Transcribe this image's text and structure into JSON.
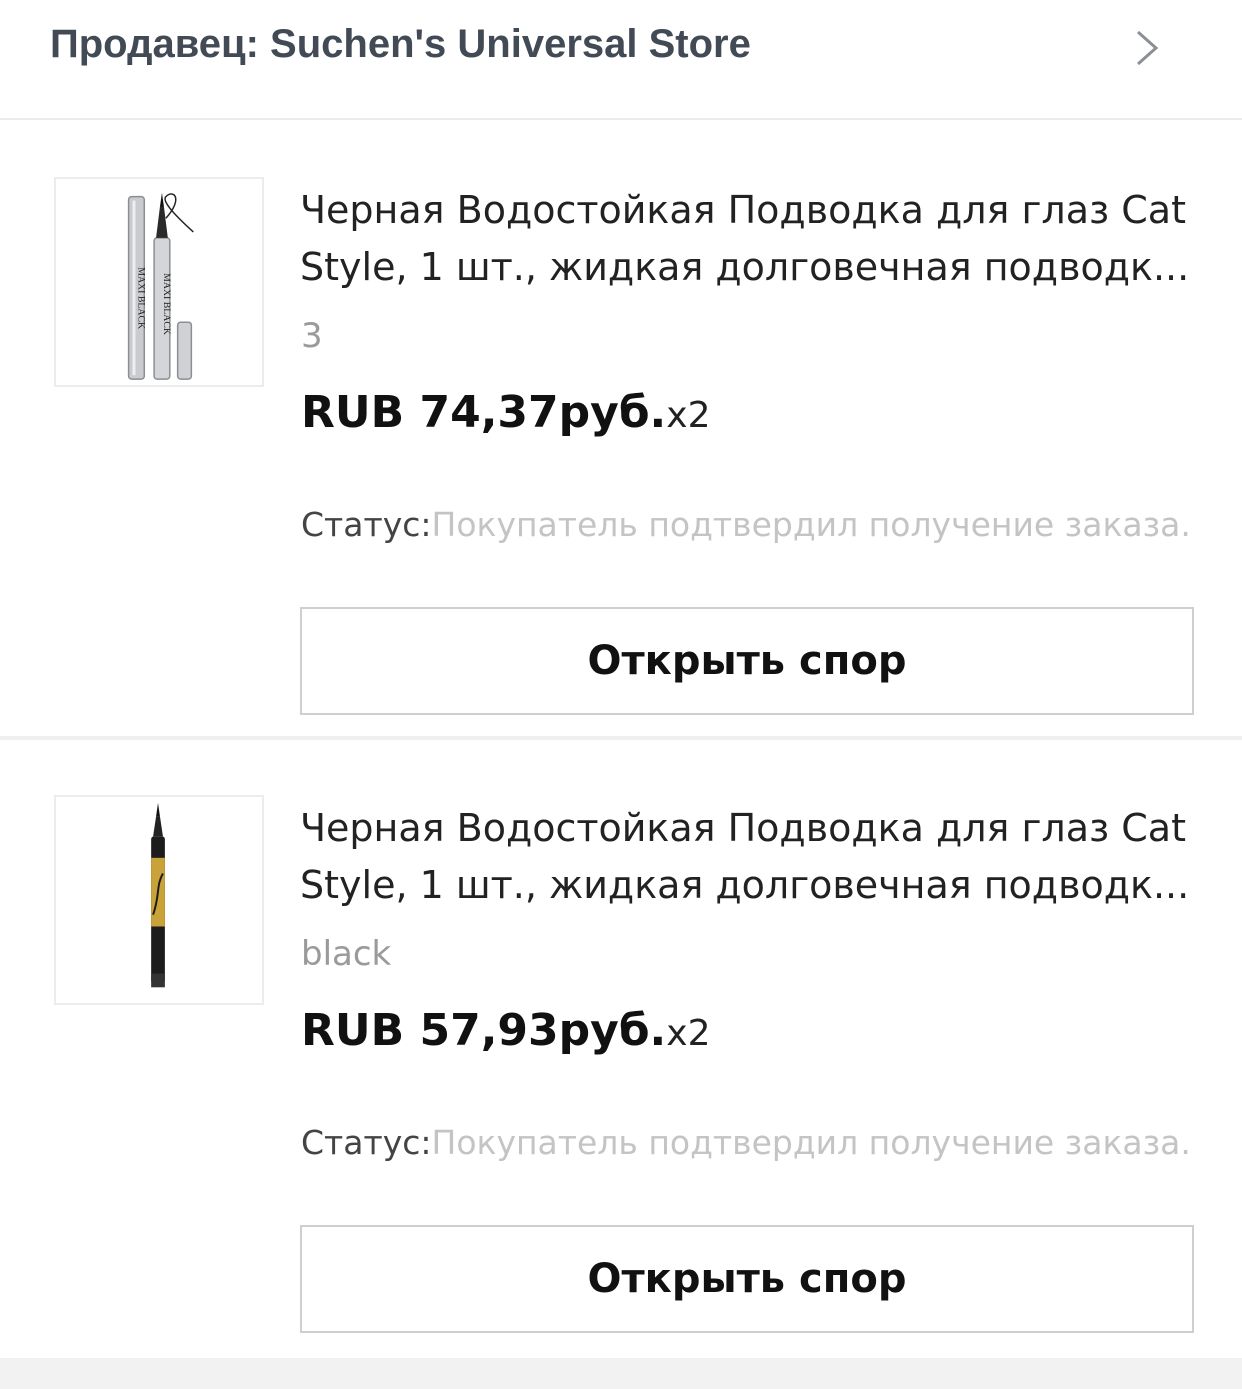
{
  "seller": {
    "title": "Продавец: Suchen's Universal Store",
    "chevron_icon": "chevron-right-icon"
  },
  "items": [
    {
      "image_icon": "eyeliner-silver-product-image",
      "image_text": "MAXI BLACK",
      "title": "Черная Водостойкая Подводка для глаз Cat Style, 1 шт., жидкая долговечная подводк...",
      "variant": "3",
      "price": "RUB 74,37руб.",
      "quantity": "x2",
      "status_label": "Статус:",
      "status_value": "Покупатель подтвердил получение заказа.",
      "button_label": "Открыть спор"
    },
    {
      "image_icon": "eyeliner-gold-product-image",
      "title": "Черная Водостойкая Подводка для глаз Cat Style, 1 шт., жидкая долговечная подводк...",
      "variant": "black",
      "price": "RUB 57,93руб.",
      "quantity": "x2",
      "status_label": "Статус:",
      "status_value": "Покупатель подтвердил получение заказа.",
      "button_label": "Открыть спор"
    }
  ]
}
